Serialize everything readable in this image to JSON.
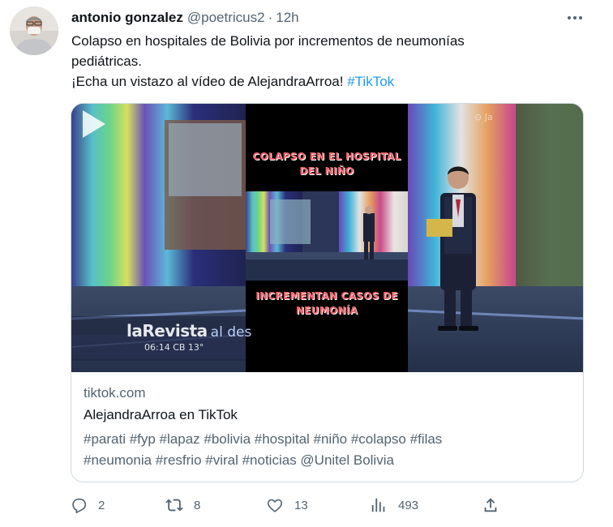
{
  "tweet": {
    "display_name": "antonio gonzalez",
    "handle": "@poetricus2",
    "separator": "·",
    "time": "12h",
    "text_line1": "Colapso en hospitales de Bolivia por incrementos de neumonías",
    "text_line2": "pediátricas.",
    "text_line3": "¡Echa un vistazo al vídeo de AlejandraArroa!",
    "hashtag": "#TikTok"
  },
  "card": {
    "video_title_top": "COLAPSO EN EL HOSPITAL DEL NIÑO",
    "video_title_bottom": "INCREMENTAN CASOS DE NEUMONÍA",
    "tv_brand": "laRevista",
    "tv_brand_suffix": "al des",
    "tv_meta": "06:14   CB 13°",
    "domain": "tiktok.com",
    "title": "AlejandraArroa en TikTok",
    "description_line1": "#parati #fyp #lapaz #bolivia #hospital #niño #colapso #filas",
    "description_line2": "#neumonia #resfrio #viral #noticias @Unitel Bolivia"
  },
  "actions": {
    "reply_count": "2",
    "retweet_count": "8",
    "like_count": "13",
    "views_count": "493"
  },
  "icons": {
    "more": "more-icon",
    "reply": "reply-icon",
    "retweet": "retweet-icon",
    "like": "like-icon",
    "views": "views-icon",
    "share": "share-icon",
    "play": "play-icon"
  },
  "colors": {
    "link": "#1d9bf0",
    "secondary_text": "#536471",
    "border": "#cfd9de"
  }
}
